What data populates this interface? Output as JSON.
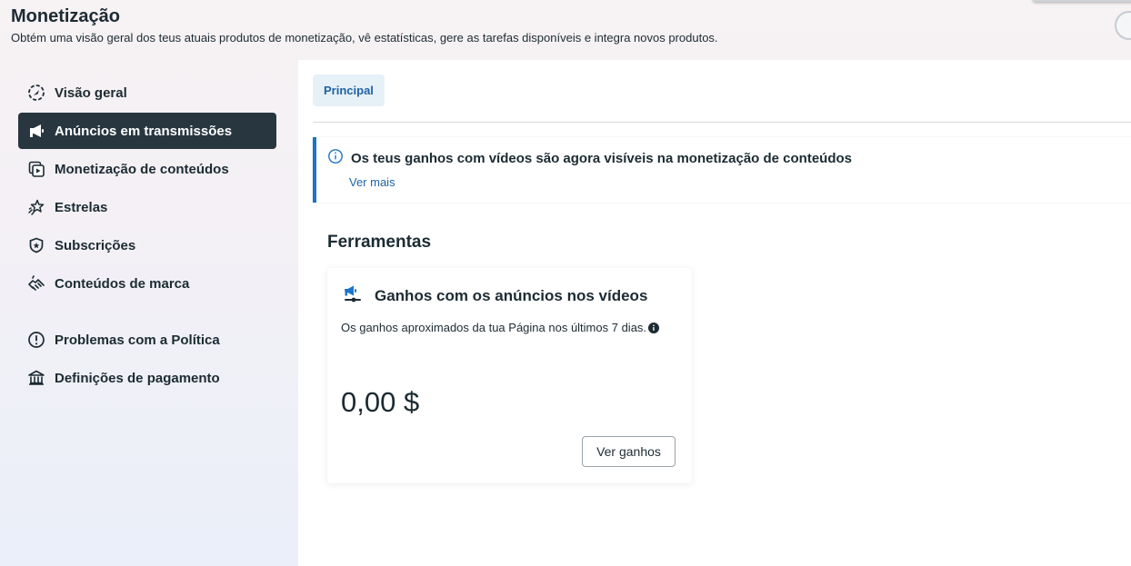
{
  "header": {
    "title": "Monetização",
    "subtitle": "Obtém uma visão geral dos teus atuais produtos de monetização, vê estatísticas, gere as tarefas disponíveis e integra novos produtos."
  },
  "sidebar": {
    "items": [
      {
        "label": "Visão geral",
        "icon": "overview-icon"
      },
      {
        "label": "Anúncios em transmissões",
        "icon": "megaphone-icon",
        "active": true
      },
      {
        "label": "Monetização de conteúdos",
        "icon": "content-play-icon"
      },
      {
        "label": "Estrelas",
        "icon": "stars-icon"
      },
      {
        "label": "Subscrições",
        "icon": "shield-icon"
      },
      {
        "label": "Conteúdos de marca",
        "icon": "handshake-icon"
      }
    ],
    "secondary_items": [
      {
        "label": "Problemas com a Política",
        "icon": "alert-circle-icon"
      },
      {
        "label": "Definições de pagamento",
        "icon": "bank-icon"
      }
    ]
  },
  "tabs": {
    "principal": "Principal"
  },
  "notice": {
    "title": "Os teus ganhos com vídeos são agora visíveis na monetização de conteúdos",
    "link": "Ver mais"
  },
  "tools": {
    "section_title": "Ferramentas",
    "card": {
      "title": "Ganhos com os anúncios nos vídeos",
      "description": "Os ganhos aproximados da tua Página nos últimos 7 dias.",
      "amount": "0,00 $",
      "button": "Ver ganhos"
    }
  },
  "colors": {
    "active_nav_bg": "#283640",
    "accent_blue": "#1b74c9",
    "link_blue": "#1f63a6",
    "tab_bg": "#e6f0f7"
  }
}
